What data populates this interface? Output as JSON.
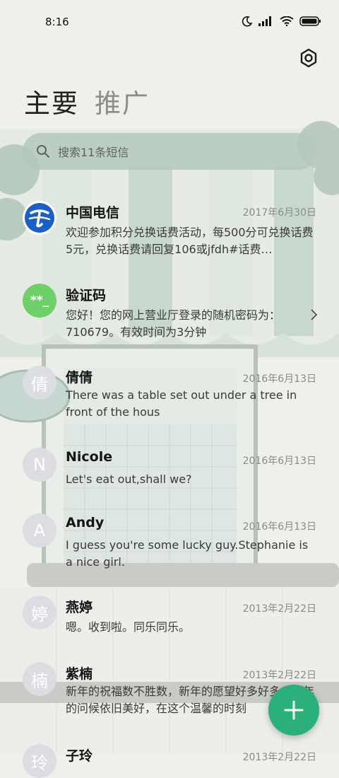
{
  "status": {
    "time": "8:16"
  },
  "tabs": [
    {
      "label": "主要",
      "active": true
    },
    {
      "label": "推广",
      "active": false
    }
  ],
  "search": {
    "placeholder": "搜索11条短信"
  },
  "conversations": [
    {
      "name": "中国电信",
      "date": "2017年6月30日",
      "snippet": "欢迎参加积分兑换话费活动，每500分可兑换话费5元，兑换话费请回复106或jfdh#话费…",
      "avatar_type": "logo"
    },
    {
      "name": "验证码",
      "date": "",
      "snippet": "您好！您的网上营业厅登录的随机密码为：710679。有效时间为3分钟",
      "avatar_type": "code",
      "avatar_text": "**_"
    },
    {
      "name": "倩倩",
      "date": "2016年6月13日",
      "snippet": "There was a table set out under a tree in front of the hous",
      "avatar_type": "letter",
      "avatar_text": "倩"
    },
    {
      "name": "Nicole",
      "date": "2016年6月13日",
      "snippet": "Let's eat out,shall we?",
      "avatar_type": "letter",
      "avatar_text": "N"
    },
    {
      "name": "Andy",
      "date": "2016年6月13日",
      "snippet": "I guess you're some lucky guy.Stephanie is a nice girl.",
      "avatar_type": "letter",
      "avatar_text": "A"
    },
    {
      "name": "燕婷",
      "date": "2013年2月22日",
      "snippet": "嗯。收到啦。同乐同乐。",
      "avatar_type": "letter",
      "avatar_text": "婷"
    },
    {
      "name": "紫楠",
      "date": "2013年2月22日",
      "snippet": "新年的祝福数不胜数，新年的愿望好多好多，新年的问候依旧美好，在这个温馨的时刻",
      "avatar_type": "letter",
      "avatar_text": "楠"
    },
    {
      "name": "子玲",
      "date": "2013年2月22日",
      "snippet": "",
      "avatar_type": "letter",
      "avatar_text": "玲"
    }
  ],
  "colors": {
    "fab": "#2bb07a",
    "code_avatar": "#6fd06a",
    "telecom_blue": "#1a5ec9"
  }
}
